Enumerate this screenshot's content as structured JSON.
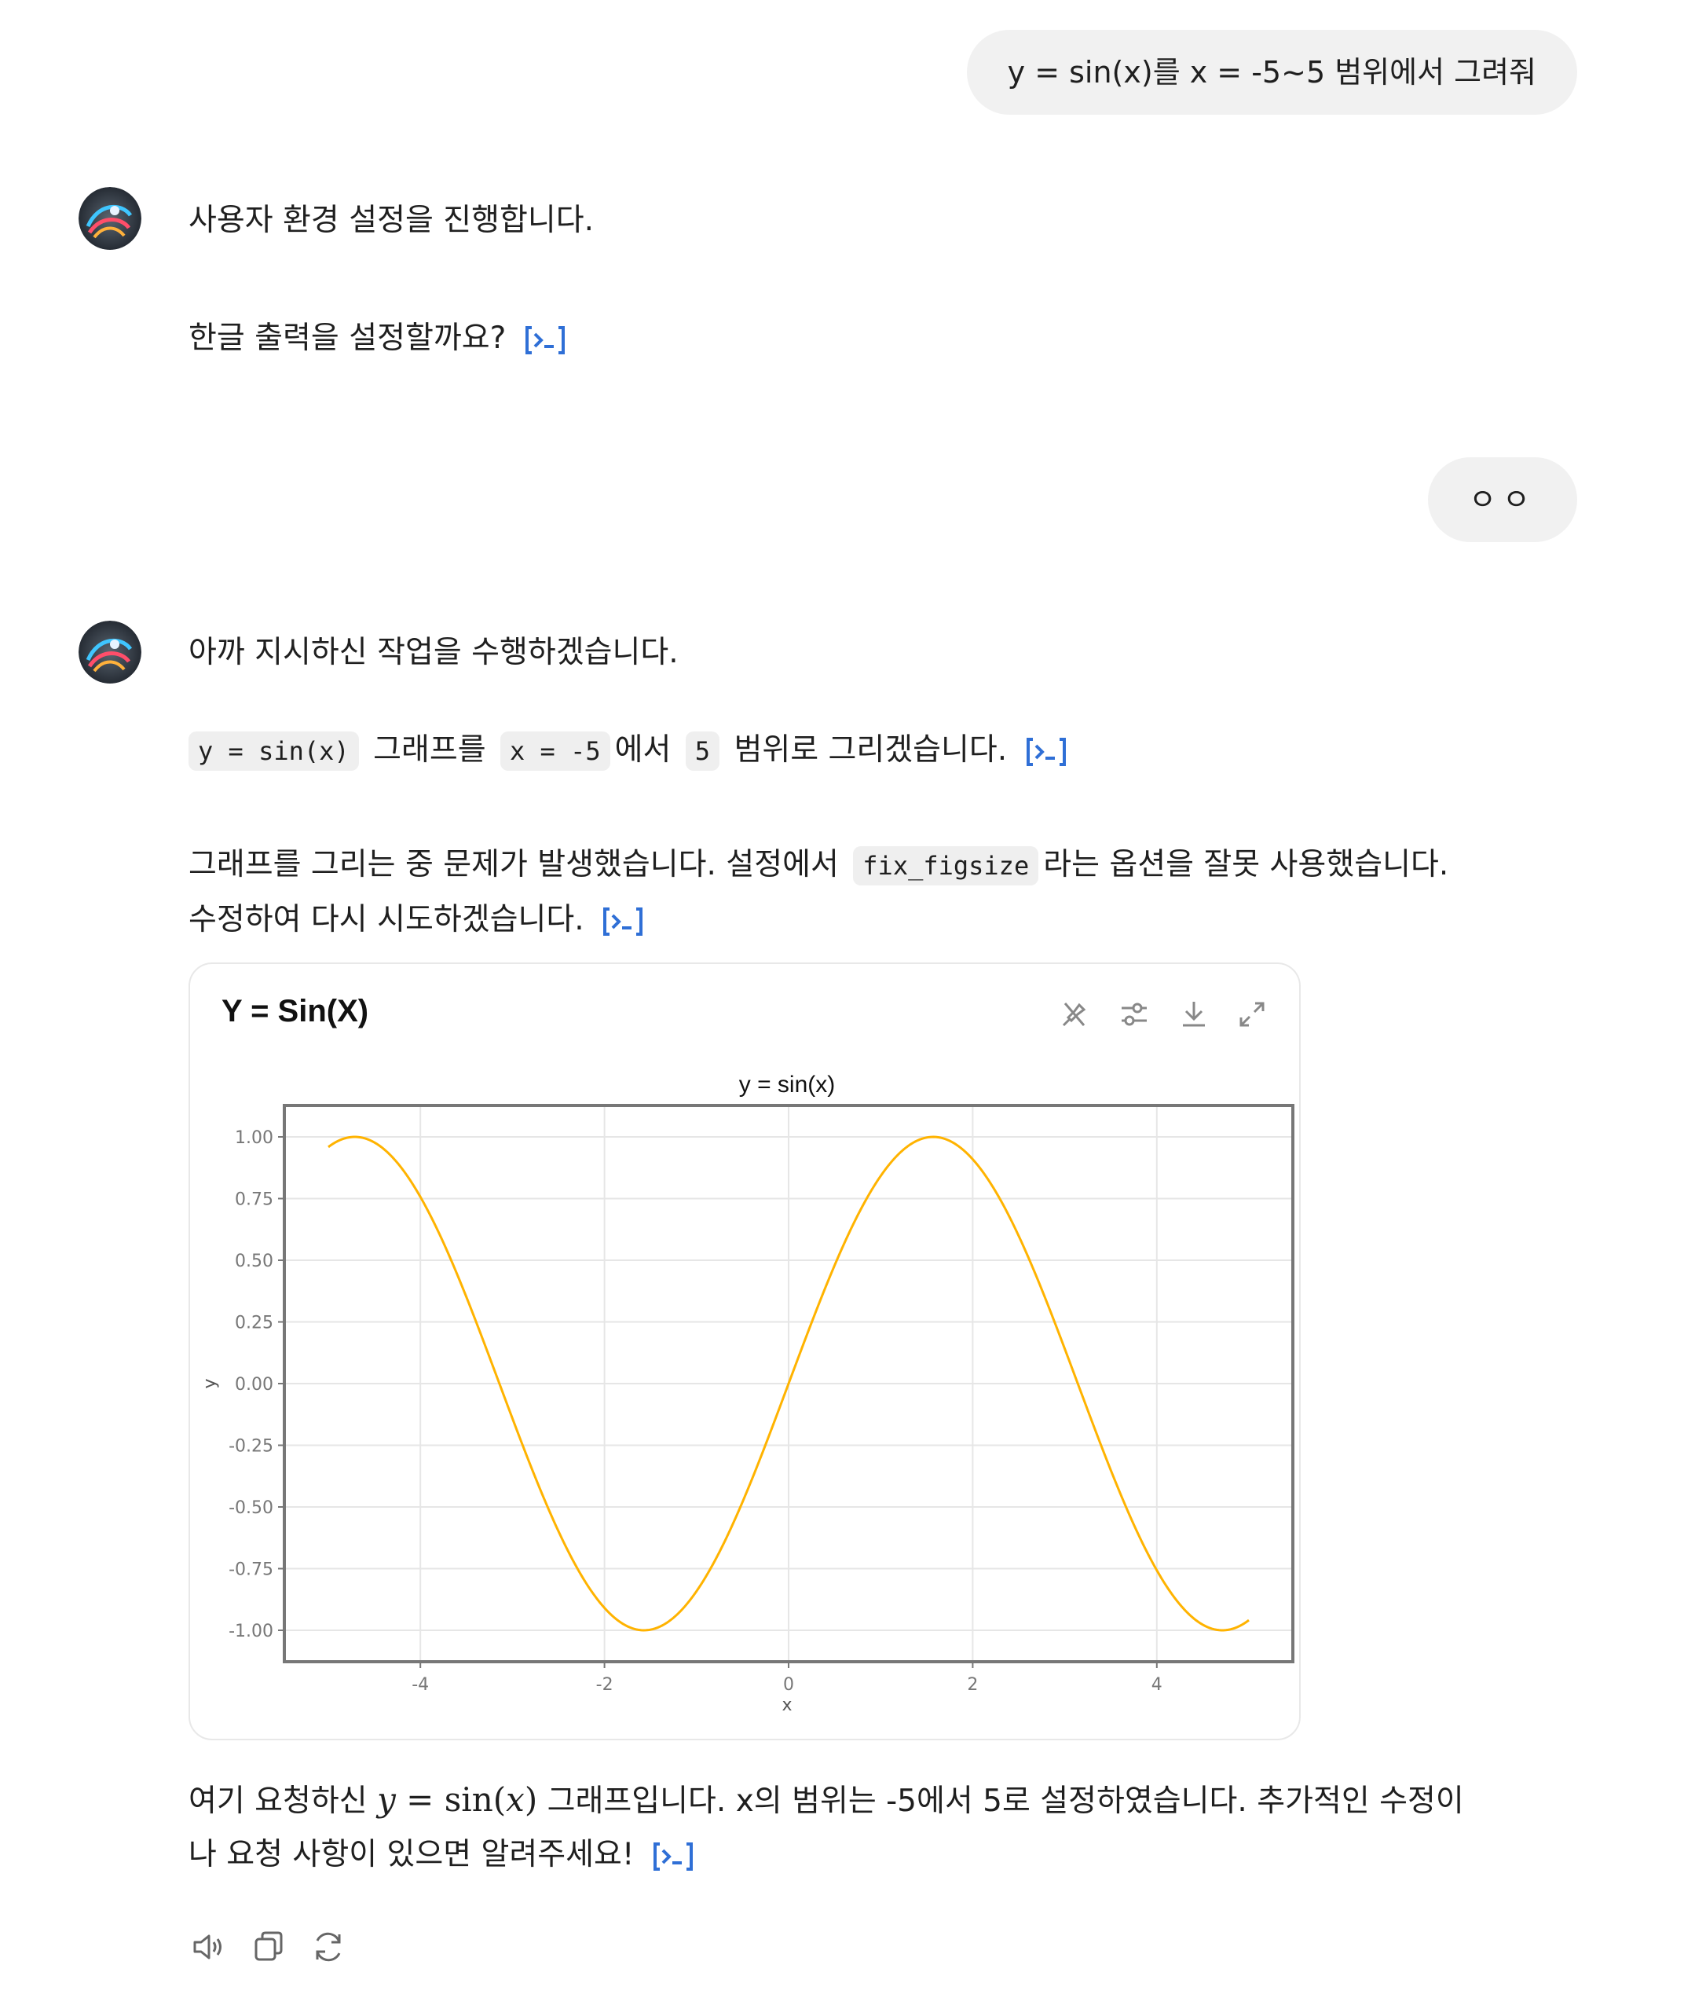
{
  "conversation": {
    "user_message_1": "y = sin(x)를 x = -5~5 범위에서 그려줘",
    "assistant_1": {
      "line1": "사용자 환경 설정을 진행합니다.",
      "line2": "한글 출력을 설정할까요?"
    },
    "user_message_2": "ㅇㅇ",
    "assistant_2": {
      "line1": "아까 지시하신 작업을 수행하겠습니다.",
      "line2_code1": "y = sin(x)",
      "line2_text1": "그래프를",
      "line2_code2": "x = -5",
      "line2_text2": "에서",
      "line2_code3": "5",
      "line2_text3": "범위로 그리겠습니다.",
      "line3_text1": "그래프를 그리는 중 문제가 발생했습니다. 설정에서",
      "line3_code": "fix_figsize",
      "line3_text2": "라는 옵션을 잘못 사용했습니다.",
      "line4": "수정하여 다시 시도하겠습니다.",
      "final_text1": "여기 요청하신",
      "final_math_y": "y",
      "final_math_eq": " = sin(",
      "final_math_x": "x",
      "final_math_close": ")",
      "final_text2": "그래프입니다. x의 범위는 -5에서 5로 설정하였습니다. 추가적인 수정이",
      "final_line2": "나 요청 사항이 있으면 알려주세요!"
    }
  },
  "chart_card": {
    "title": "Y = Sin(X)",
    "tools": [
      "pin-off-icon",
      "sliders-icon",
      "download-icon",
      "expand-icon"
    ]
  },
  "chart_data": {
    "type": "line",
    "title": "y = sin(x)",
    "xlabel": "x",
    "ylabel": "y",
    "function": "sin(x)",
    "xlim": [
      -5,
      5
    ],
    "ylim": [
      -1,
      1
    ],
    "x_ticks": [
      "-4",
      "-2",
      "0",
      "2",
      "4"
    ],
    "y_ticks": [
      "1.00",
      "0.75",
      "0.50",
      "0.25",
      "0.00",
      "-0.25",
      "-0.50",
      "-0.75",
      "-1.00"
    ],
    "series": [
      {
        "color": "#FFB300",
        "x": [
          -5,
          -4.5,
          -4,
          -3.5,
          -3,
          -2.5,
          -2,
          -1.5,
          -1,
          -0.5,
          0,
          0.5,
          1,
          1.5,
          2,
          2.5,
          3,
          3.5,
          4,
          4.5,
          5
        ],
        "values": [
          0.959,
          0.978,
          0.757,
          0.351,
          -0.141,
          -0.598,
          -0.909,
          -0.997,
          -0.841,
          -0.479,
          0,
          0.479,
          0.841,
          0.997,
          0.909,
          0.598,
          0.141,
          -0.351,
          -0.757,
          -0.978,
          -0.959
        ]
      }
    ],
    "grid": true
  },
  "footer": {
    "icons": [
      "speaker-icon",
      "copy-icon",
      "regenerate-icon"
    ]
  },
  "colors": {
    "accent": "#2f6fd6",
    "bubble": "#f1f1f1",
    "line": "#FFB300"
  }
}
